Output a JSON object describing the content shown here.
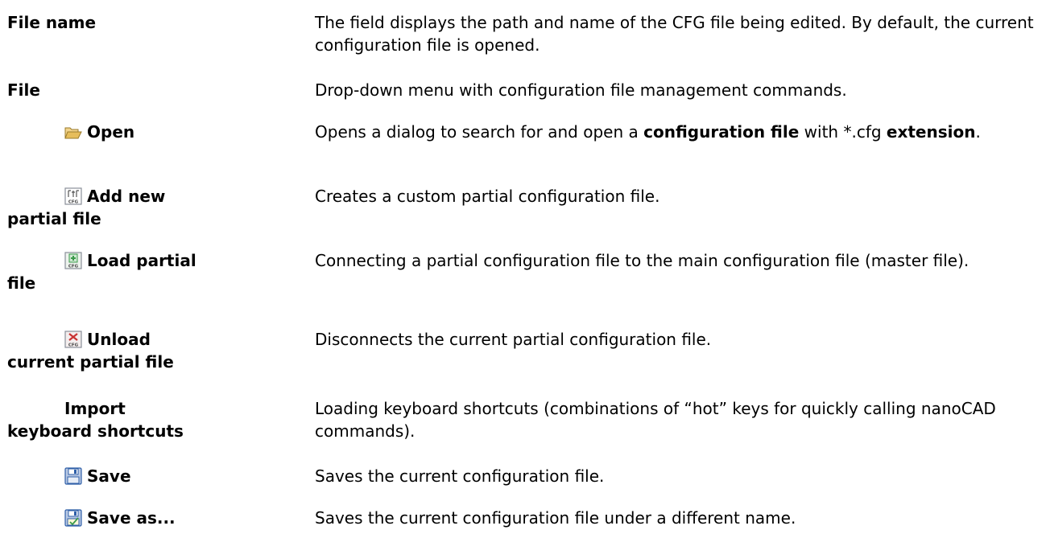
{
  "rows": [
    {
      "term_line1": "File name",
      "term_line2": "",
      "icon": "",
      "desc": "The field displays the path and name of the CFG file being edited. By default, the current configuration file is opened."
    },
    {
      "term_line1": "File",
      "term_line2": "",
      "icon": "",
      "desc": "Drop-down menu with configuration file management commands."
    },
    {
      "term_line1": "Open",
      "term_line2": "",
      "icon": "open-folder-icon",
      "desc_parts": [
        "Opens a dialog to search for and open a ",
        "configuration file",
        " with *.cfg ",
        "extension",
        "."
      ]
    },
    {
      "term_line1": "Add new",
      "term_line2": "partial file",
      "icon": "cfg-add-new-icon",
      "desc": "Creates a custom partial configuration file."
    },
    {
      "term_line1": "Load partial",
      "term_line2": "file",
      "icon": "cfg-load-icon",
      "desc": "Connecting a partial configuration file to the main configuration file (master file)."
    },
    {
      "term_line1": "Unload",
      "term_line2": "current partial file",
      "icon": "cfg-unload-icon",
      "desc": "Disconnects the current partial configuration file."
    },
    {
      "term_line1": "Import",
      "term_line2": "keyboard shortcuts",
      "icon": "",
      "desc": "Loading keyboard shortcuts (combinations of “hot” keys for quickly calling nanoCAD commands)."
    },
    {
      "term_line1": "Save",
      "term_line2": "",
      "icon": "save-icon",
      "desc": "Saves the current configuration file."
    },
    {
      "term_line1": "Save as...",
      "term_line2": "",
      "icon": "save-as-icon",
      "desc": "Saves the current configuration file under a different name."
    }
  ],
  "colors": {
    "folder": "#d9a441",
    "cfg_gray": "#8a8f99",
    "cfg_green": "#3a9a4a",
    "cfg_red": "#c83232",
    "save_blue": "#2f5fa8"
  }
}
